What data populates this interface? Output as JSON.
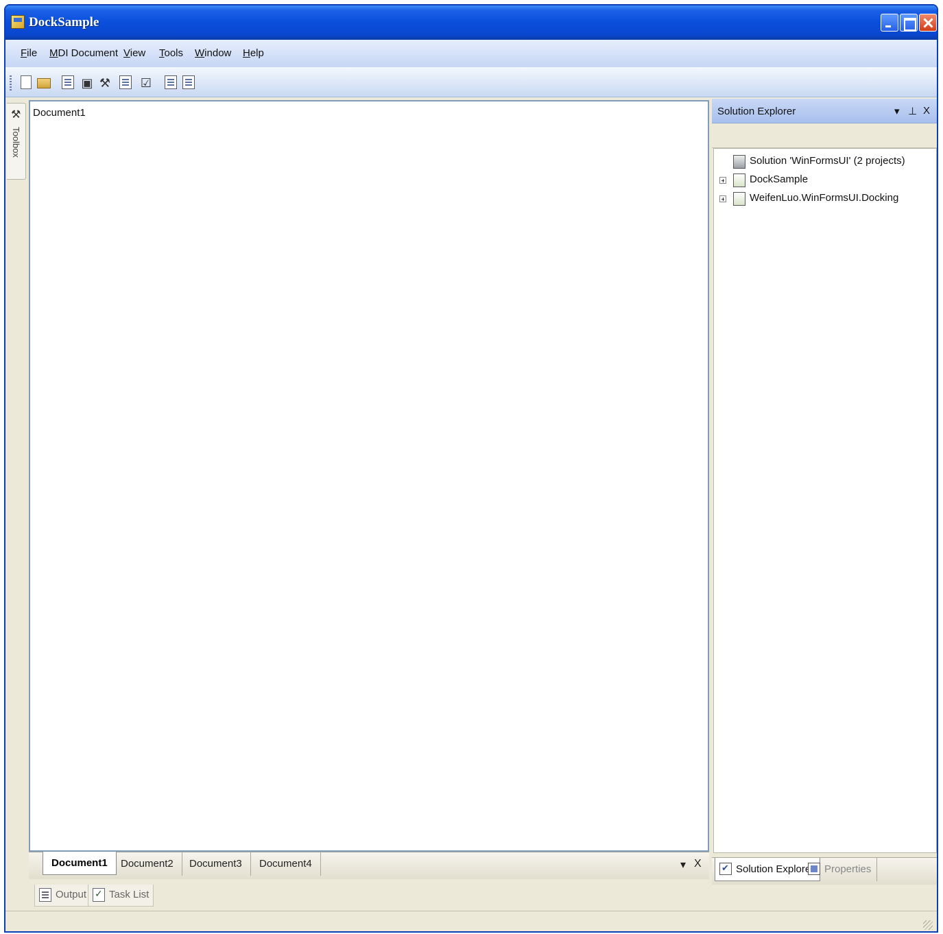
{
  "window": {
    "title": "DockSample"
  },
  "menu": {
    "items": [
      "File",
      "MDI Document",
      "View",
      "Tools",
      "Window",
      "Help"
    ]
  },
  "toolbar": {
    "icons": [
      "new-document-icon",
      "open-folder-icon",
      "solution-explorer-icon",
      "properties-icon",
      "toolbox-icon",
      "output-icon",
      "task-list-icon",
      "document-icon",
      "new-window-icon"
    ]
  },
  "toolbox": {
    "label": "Toolbox"
  },
  "document": {
    "content": "Document1"
  },
  "doc_tabs": {
    "tabs": [
      "Document1",
      "Document2",
      "Document3",
      "Document4"
    ],
    "active_index": 0,
    "dropdown_glyph": "▾",
    "close_glyph": "X"
  },
  "bottom_panel_tabs": [
    "Output",
    "Task List"
  ],
  "solution_explorer": {
    "title": "Solution Explorer",
    "dropdown_glyph": "▾",
    "pin_glyph": "⊥",
    "close_glyph": "X",
    "tree": [
      {
        "label": "Solution 'WinFormsUI' (2 projects)",
        "expandable": false
      },
      {
        "label": "DockSample",
        "expandable": true
      },
      {
        "label": "WeifenLuo.WinFormsUI.Docking",
        "expandable": true
      }
    ]
  },
  "right_panel_tabs": {
    "tabs": [
      "Solution Explorer",
      "Properties"
    ],
    "active_index": 0
  },
  "colors": {
    "title_bar": "#0a4fdc",
    "menu_bar": "#c6d6f5",
    "panel_header": "#a8c0ee",
    "chrome": "#ece9d8"
  }
}
